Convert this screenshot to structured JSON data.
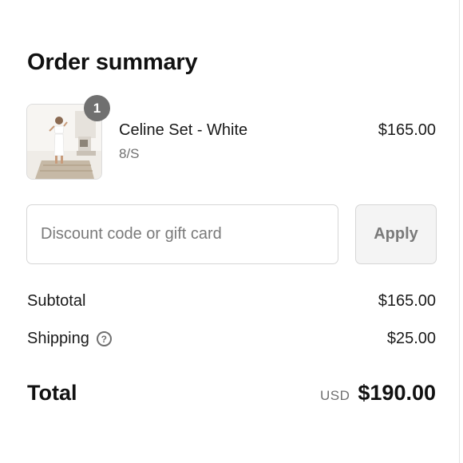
{
  "summary": {
    "title": "Order summary"
  },
  "line_item": {
    "quantity": "1",
    "name": "Celine Set - White",
    "variant": "8/S",
    "price": "$165.00",
    "image_icon": "product-photo"
  },
  "discount": {
    "placeholder": "Discount code or gift card",
    "value": "",
    "apply_label": "Apply"
  },
  "totals": {
    "subtotal_label": "Subtotal",
    "subtotal_value": "$165.00",
    "shipping_label": "Shipping",
    "shipping_help_icon": "question-circle-icon",
    "shipping_value": "$25.00",
    "total_label": "Total",
    "currency": "USD",
    "total_value": "$190.00"
  }
}
